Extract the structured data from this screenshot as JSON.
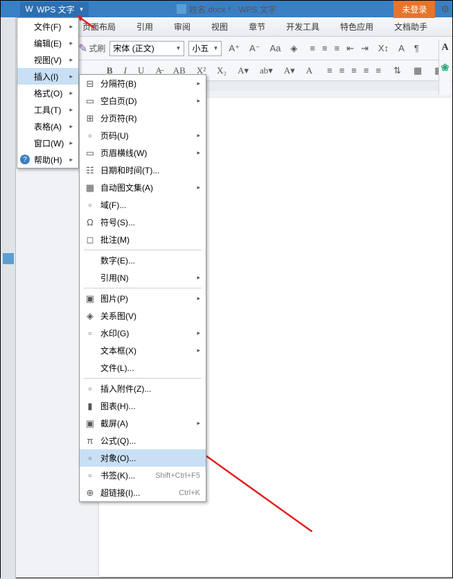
{
  "titlebar": {
    "app_name": "WPS 文字",
    "doc_title": "姓名.docx * - WPS 文字",
    "login_label": "未登录"
  },
  "menubar": {
    "items": [
      "页面布局",
      "引用",
      "审阅",
      "视图",
      "章节",
      "开发工具",
      "特色应用",
      "文档助手"
    ]
  },
  "toolbar": {
    "brush_label": "式刷",
    "font_name": "宋体 (正文)",
    "font_size": "小五"
  },
  "tab": {
    "label": "..."
  },
  "main_menu": {
    "items": [
      {
        "label": "文件(F)",
        "arrow": true
      },
      {
        "label": "编辑(E)",
        "arrow": true
      },
      {
        "label": "视图(V)",
        "arrow": true
      },
      {
        "label": "插入(I)",
        "arrow": true,
        "active": true
      },
      {
        "label": "格式(O)",
        "arrow": true
      },
      {
        "label": "工具(T)",
        "arrow": true
      },
      {
        "label": "表格(A)",
        "arrow": true
      },
      {
        "label": "窗口(W)",
        "arrow": true
      },
      {
        "label": "帮助(H)",
        "arrow": true,
        "help": true
      }
    ]
  },
  "sub_menu": {
    "items": [
      {
        "label": "分隔符(B)",
        "icon": "⊟",
        "arrow": true
      },
      {
        "label": "空白页(D)",
        "icon": "▭",
        "arrow": true
      },
      {
        "label": "分页符(R)",
        "icon": "⊞"
      },
      {
        "label": "页码(U)",
        "icon": "▫",
        "arrow": true
      },
      {
        "label": "页眉横线(W)",
        "icon": "▭",
        "arrow": true
      },
      {
        "label": "日期和时间(T)...",
        "icon": "☷"
      },
      {
        "label": "自动图文集(A)",
        "icon": "▦",
        "arrow": true
      },
      {
        "label": "域(F)...",
        "icon": "▫"
      },
      {
        "label": "符号(S)...",
        "icon": "Ω"
      },
      {
        "label": "批注(M)",
        "icon": "◻"
      },
      {
        "sep": true
      },
      {
        "label": "数字(E)...",
        "icon": ""
      },
      {
        "label": "引用(N)",
        "icon": "",
        "arrow": true
      },
      {
        "sep": true
      },
      {
        "label": "图片(P)",
        "icon": "▣",
        "arrow": true
      },
      {
        "label": "关系图(V)",
        "icon": "◈"
      },
      {
        "label": "水印(G)",
        "icon": "▫",
        "arrow": true
      },
      {
        "label": "文本框(X)",
        "icon": "",
        "arrow": true
      },
      {
        "label": "文件(L)...",
        "icon": ""
      },
      {
        "sep": true
      },
      {
        "label": "插入附件(Z)...",
        "icon": "▫"
      },
      {
        "label": "图表(H)...",
        "icon": "▮"
      },
      {
        "label": "截屏(A)",
        "icon": "▣",
        "arrow": true
      },
      {
        "label": "公式(Q)...",
        "icon": "π"
      },
      {
        "label": "对象(O)...",
        "icon": "▫",
        "highlighted": true
      },
      {
        "label": "书签(K)...",
        "icon": "▫",
        "shortcut": "Shift+Ctrl+F5"
      },
      {
        "label": "超链接(I)...",
        "icon": "⊕",
        "shortcut": "Ctrl+K"
      }
    ]
  }
}
